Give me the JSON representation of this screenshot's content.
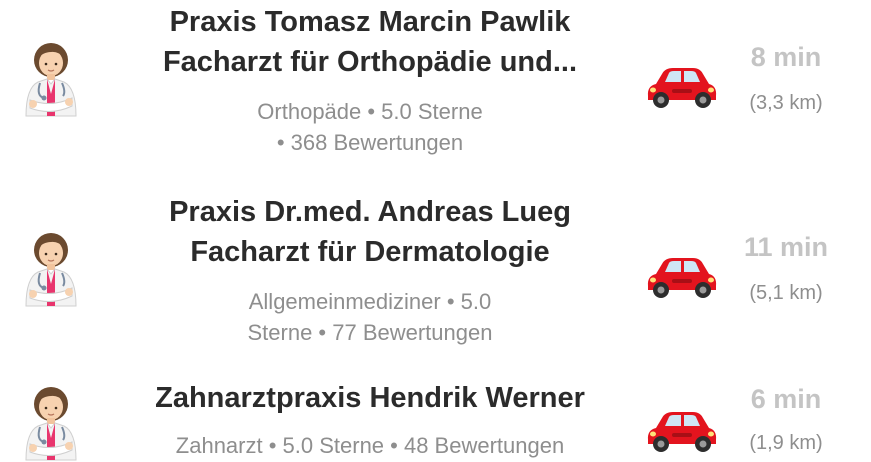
{
  "results": [
    {
      "title_line1": "Praxis Tomasz Marcin Pawlik",
      "title_line2": "Facharzt für Orthopädie und...",
      "subtitle_line1": "Orthopäde • 5.0 Sterne",
      "subtitle_line2": "• 368 Bewertungen",
      "avatar_icon": "doctor-icon",
      "travel_icon": "car-icon",
      "time": "8 min",
      "distance": "(3,3 km)"
    },
    {
      "title_line1": "Praxis Dr.med. Andreas Lueg",
      "title_line2": "Facharzt für Dermatologie",
      "subtitle_line1": "Allgemeinmediziner • 5.0",
      "subtitle_line2": "Sterne • 77 Bewertungen",
      "avatar_icon": "doctor-icon",
      "travel_icon": "car-icon",
      "time": "11 min",
      "distance": "(5,1 km)"
    },
    {
      "title_line1": "Zahnarztpraxis Hendrik Werner",
      "subtitle_line1": "Zahnarzt • 5.0 Sterne • 48 Bewertungen",
      "avatar_icon": "doctor-icon",
      "travel_icon": "car-icon",
      "time": "6 min",
      "distance": "(1,9 km)"
    }
  ],
  "colors": {
    "title": "#2b2b2b",
    "subtitle": "#8e8e8e",
    "time": "#c4c4c4",
    "car_body": "#e3141e",
    "scrub_pink": "#e8356d"
  }
}
